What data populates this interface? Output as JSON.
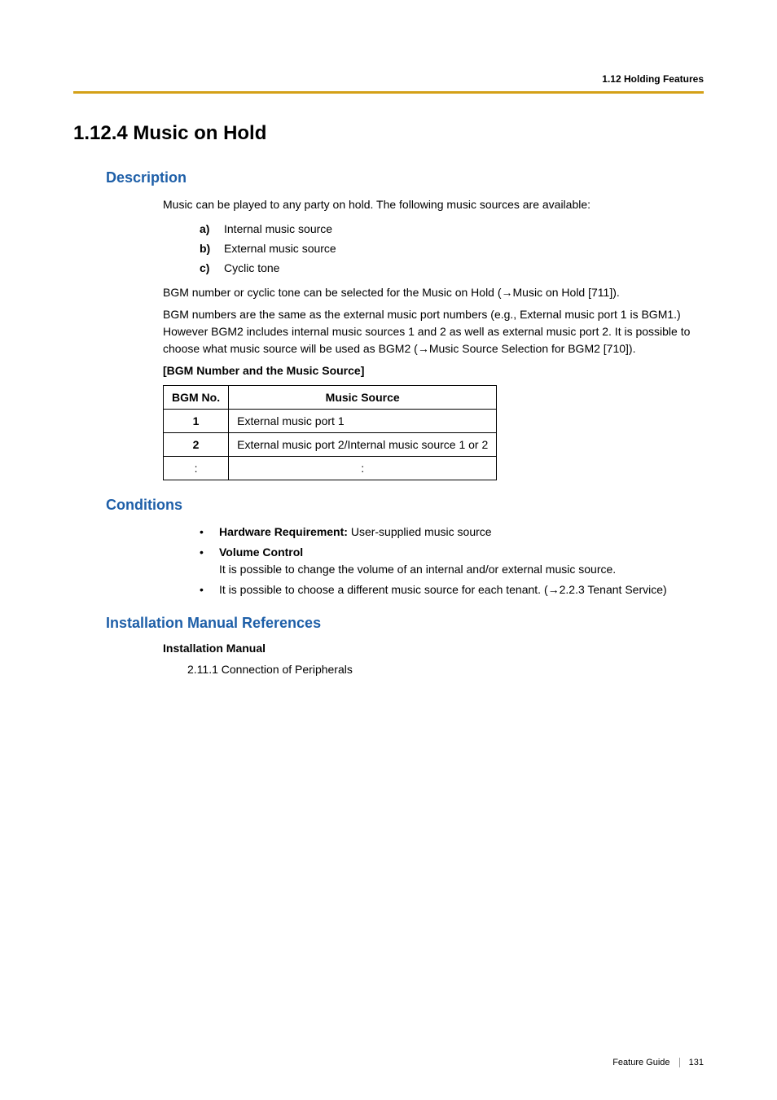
{
  "header": {
    "breadcrumb": "1.12 Holding Features"
  },
  "page": {
    "title": "1.12.4  Music on Hold"
  },
  "description": {
    "heading": "Description",
    "intro": "Music can be played to any party on hold. The following music sources are available:",
    "items": {
      "a": {
        "marker": "a)",
        "text": "Internal music source"
      },
      "b": {
        "marker": "b)",
        "text": "External music source"
      },
      "c": {
        "marker": "c)",
        "text": "Cyclic tone"
      }
    },
    "para1_before": "BGM number or cyclic tone can be selected for the Music on Hold (",
    "para1_link": "Music on Hold [711]).",
    "para2_before": "BGM numbers are the same as the external music port numbers (e.g., External music port 1 is BGM1.) However BGM2 includes internal music sources 1 and 2 as well as external music port 2. It is possible to choose what music source will be used as BGM2 (",
    "para2_link": "Music Source Selection for BGM2 [710]).",
    "table_heading": "[BGM Number and the Music Source]",
    "table": {
      "col1": "BGM No.",
      "col2": "Music Source",
      "r1c1": "1",
      "r1c2": "External music port 1",
      "r2c1": "2",
      "r2c2": "External music port 2/Internal music source 1 or 2",
      "r3c1": ":",
      "r3c2": ":"
    }
  },
  "conditions": {
    "heading": "Conditions",
    "item1_bold": "Hardware Requirement: ",
    "item1_text": "User-supplied music source",
    "item2_bold": "Volume Control",
    "item2_text": "It is possible to change the volume of an internal and/or external music source.",
    "item3_before": "It is possible to choose a different music source for each tenant. (",
    "item3_link": "2.2.3 Tenant Service)"
  },
  "installation": {
    "heading": "Installation Manual References",
    "subheading": "Installation Manual",
    "ref": "2.11.1 Connection of Peripherals"
  },
  "footer": {
    "label": "Feature Guide",
    "page": "131"
  },
  "glyphs": {
    "arrow": "→",
    "bullet": "•"
  }
}
